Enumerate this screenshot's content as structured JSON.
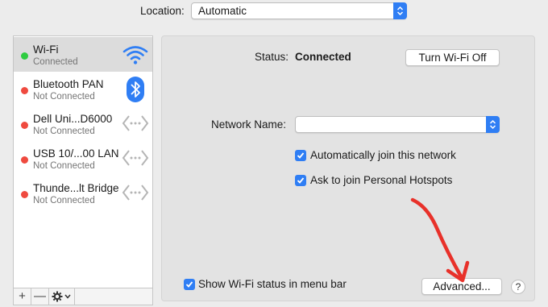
{
  "location": {
    "label": "Location:",
    "value": "Automatic"
  },
  "services": [
    {
      "name": "Wi-Fi",
      "status": "Connected",
      "status_color": "#2ecc40",
      "icon": "wifi-icon",
      "selected": true
    },
    {
      "name": "Bluetooth PAN",
      "status": "Not Connected",
      "status_color": "#ef4a3f",
      "icon": "bluetooth-icon",
      "selected": false
    },
    {
      "name": "Dell Uni...D6000",
      "status": "Not Connected",
      "status_color": "#ef4a3f",
      "icon": "ethernet-icon",
      "selected": false
    },
    {
      "name": "USB 10/...00 LAN",
      "status": "Not Connected",
      "status_color": "#ef4a3f",
      "icon": "ethernet-icon",
      "selected": false
    },
    {
      "name": "Thunde...lt Bridge",
      "status": "Not Connected",
      "status_color": "#ef4a3f",
      "icon": "ethernet-icon",
      "selected": false
    }
  ],
  "sidebar_footer": {
    "add": "+",
    "remove": "—",
    "gear": "gear-icon"
  },
  "panel": {
    "status_label": "Status:",
    "status_value": "Connected",
    "turn_off_button": "Turn Wi-Fi Off",
    "network_name_label": "Network Name:",
    "network_name_value": "",
    "auto_join_label": "Automatically join this network",
    "auto_join_checked": true,
    "ask_hotspots_label": "Ask to join Personal Hotspots",
    "ask_hotspots_checked": true,
    "show_status_label": "Show Wi-Fi status in menu bar",
    "show_status_checked": true,
    "advanced_button": "Advanced...",
    "help": "?"
  },
  "annotation": {
    "arrow_color": "#e8312a",
    "icon": "red-arrow-icon"
  },
  "colors": {
    "accent": "#2f7ef4",
    "connected": "#2ecc40",
    "disconnected": "#ef4a3f"
  }
}
